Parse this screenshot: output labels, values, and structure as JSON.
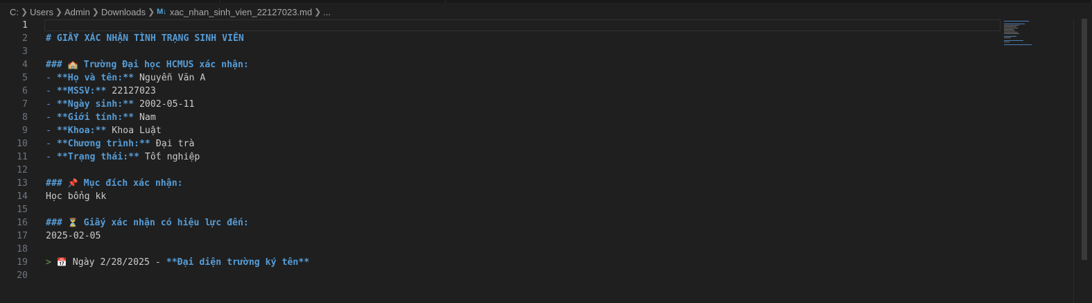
{
  "breadcrumb": {
    "items": [
      "C:",
      "Users",
      "Admin",
      "Downloads"
    ],
    "file_icon": "M↓",
    "file_name": "xac_nhan_sinh_vien_22127023.md",
    "more": "..."
  },
  "editor": {
    "active_line": 1,
    "lines": [
      {
        "n": "1",
        "parts": []
      },
      {
        "n": "2",
        "parts": [
          {
            "c": "h",
            "t": "# GIẤY XÁC NHẬN TÌNH TRẠNG SINH VIÊN"
          }
        ]
      },
      {
        "n": "3",
        "parts": []
      },
      {
        "n": "4",
        "parts": [
          {
            "c": "h",
            "t": "### "
          },
          {
            "c": "emo",
            "t": "🏫"
          },
          {
            "c": "h",
            "t": " Trường Đại học HCMUS xác nhận:"
          }
        ]
      },
      {
        "n": "5",
        "parts": [
          {
            "c": "mk",
            "t": "- "
          },
          {
            "c": "b",
            "t": "**Họ và tên:**"
          },
          {
            "c": "t",
            "t": " Nguyễn Văn A"
          }
        ]
      },
      {
        "n": "6",
        "parts": [
          {
            "c": "mk",
            "t": "- "
          },
          {
            "c": "b",
            "t": "**MSSV:**"
          },
          {
            "c": "t",
            "t": " 22127023"
          }
        ]
      },
      {
        "n": "7",
        "parts": [
          {
            "c": "mk",
            "t": "- "
          },
          {
            "c": "b",
            "t": "**Ngày sinh:**"
          },
          {
            "c": "t",
            "t": " 2002-05-11"
          }
        ]
      },
      {
        "n": "8",
        "parts": [
          {
            "c": "mk",
            "t": "- "
          },
          {
            "c": "b",
            "t": "**Giới tính:**"
          },
          {
            "c": "t",
            "t": " Nam"
          }
        ]
      },
      {
        "n": "9",
        "parts": [
          {
            "c": "mk",
            "t": "- "
          },
          {
            "c": "b",
            "t": "**Khoa:**"
          },
          {
            "c": "t",
            "t": " Khoa Luật"
          }
        ]
      },
      {
        "n": "10",
        "parts": [
          {
            "c": "mk",
            "t": "- "
          },
          {
            "c": "b",
            "t": "**Chương trình:**"
          },
          {
            "c": "t",
            "t": " Đại trà"
          }
        ]
      },
      {
        "n": "11",
        "parts": [
          {
            "c": "mk",
            "t": "- "
          },
          {
            "c": "b",
            "t": "**Trạng thái:**"
          },
          {
            "c": "t",
            "t": " Tốt nghiệp"
          }
        ]
      },
      {
        "n": "12",
        "parts": []
      },
      {
        "n": "13",
        "parts": [
          {
            "c": "h",
            "t": "### "
          },
          {
            "c": "emo",
            "t": "📌"
          },
          {
            "c": "h",
            "t": " Mục đích xác nhận:"
          }
        ]
      },
      {
        "n": "14",
        "parts": [
          {
            "c": "t",
            "t": "Học bổng kk"
          }
        ]
      },
      {
        "n": "15",
        "parts": []
      },
      {
        "n": "16",
        "parts": [
          {
            "c": "h",
            "t": "### "
          },
          {
            "c": "emo",
            "t": "⏳"
          },
          {
            "c": "h",
            "t": " Giấy xác nhận có hiệu lực đến:"
          }
        ]
      },
      {
        "n": "17",
        "parts": [
          {
            "c": "t",
            "t": "2025-02-05"
          }
        ]
      },
      {
        "n": "18",
        "parts": []
      },
      {
        "n": "19",
        "parts": [
          {
            "c": "q",
            "t": "> "
          },
          {
            "c": "emo",
            "t": "📅"
          },
          {
            "c": "t",
            "t": " Ngày 2/28/2025 - "
          },
          {
            "c": "b",
            "t": "**Đại diện trường ký tên**"
          }
        ]
      },
      {
        "n": "20",
        "parts": []
      }
    ]
  },
  "colors": {
    "background": "#1f1f1f",
    "heading": "#569cd6",
    "text": "#cccccc",
    "line_number": "#6e7681",
    "quote": "#6a9955"
  }
}
